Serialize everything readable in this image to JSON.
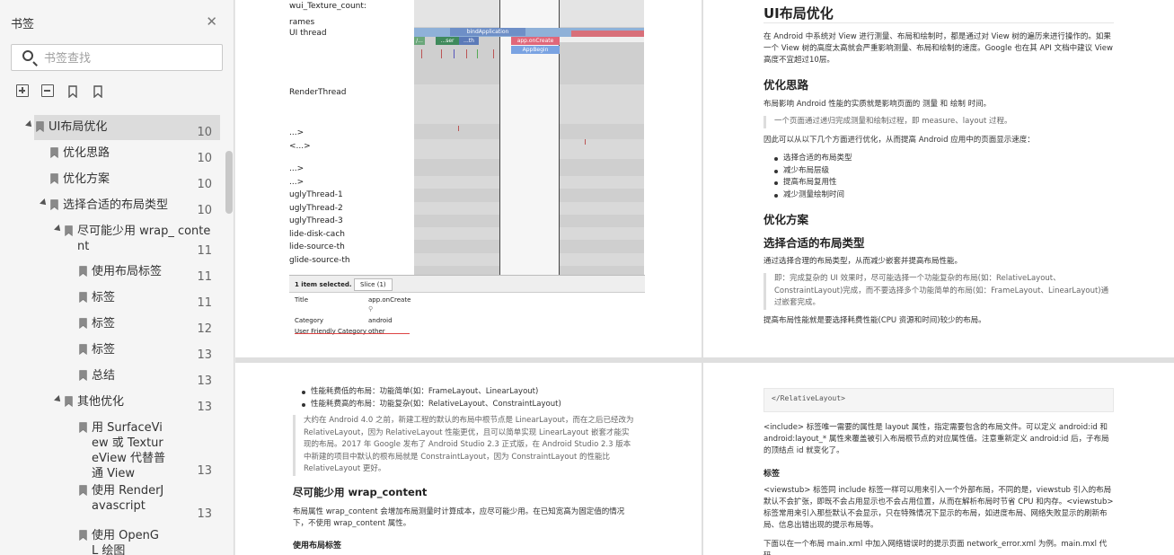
{
  "sidebar": {
    "title": "书签",
    "close_icon": "close-icon",
    "search": {
      "placeholder": "书签查找"
    },
    "tools": [
      "add-bookmark-icon",
      "remove-bookmark-icon",
      "bookmark-icon",
      "bookmark-outline-icon"
    ],
    "items": [
      {
        "label": "UI布局优化",
        "page": "10",
        "level": 0,
        "expanded": true,
        "selected": true
      },
      {
        "label": "优化思路",
        "page": "10",
        "level": 1
      },
      {
        "label": "优化方案",
        "page": "10",
        "level": 1
      },
      {
        "label": "选择合适的布局类型",
        "page": "10",
        "level": 1,
        "expanded": true
      },
      {
        "label": "尽可能少用 wrap_ content",
        "page": "11",
        "level": 2,
        "expanded": true
      },
      {
        "label": "使用布局标签",
        "page": "11",
        "level": 3
      },
      {
        "label": " 标签",
        "page": "11",
        "level": 3
      },
      {
        "label": " 标签",
        "page": "12",
        "level": 3
      },
      {
        "label": " 标签",
        "page": "13",
        "level": 3
      },
      {
        "label": "总结",
        "page": "13",
        "level": 3
      },
      {
        "label": "其他优化",
        "page": "13",
        "level": 2,
        "expanded": true
      },
      {
        "label": "用 SurfaceView 或 TextureView 代替普通 View",
        "page": "13",
        "level": 3
      },
      {
        "label": "使用 RenderJavascript",
        "page": "13",
        "level": 3
      },
      {
        "label": "使用 OpenGL 绘图",
        "page": "",
        "level": 3
      }
    ]
  },
  "page1": {
    "tracks": [
      "wui_Texture_count:",
      "rames",
      "UI thread",
      "RenderThread",
      "...>",
      "<...>",
      "...>",
      "...>",
      "uglyThread-1",
      "uglyThread-2",
      "uglyThread-3",
      "lide-disk-cach",
      "lide-source-th",
      "glide-source-th"
    ],
    "slices": [
      "bindApplication",
      "app.onCreate",
      "AppBegin",
      "/...",
      "...ser",
      "...th"
    ],
    "panel": {
      "selected": "1 item selected.",
      "tab": "Slice (1)",
      "rows": [
        {
          "key": "Title",
          "value": "app.onCreate"
        },
        {
          "key": "Category",
          "value": "android"
        },
        {
          "key": "User Friendly Category",
          "value": "other"
        }
      ]
    }
  },
  "page2": {
    "title": "UI布局优化",
    "intro": "在 Android 中系统对 View 进行测量、布局和绘制时，都是通过对 View 树的遍历来进行操作的。如果一个 View 树的高度太高就会严重影响测量、布局和绘制的速度。Google 也在其 API 文档中建议 View 高度不宜超过10层。",
    "h_ideas": "优化思路",
    "ideas_p": "布局影响 Android 性能的实质就是影响页面的 测量 和 绘制 时间。",
    "ideas_quote": "一个页面通过递归完成测量和绘制过程，即 measure、layout 过程。",
    "ideas_p2": "因此可以从以下几个方面进行优化，从而提高 Android 应用中的页面显示速度：",
    "bullets": [
      "选择合适的布局类型",
      "减少布局层级",
      "提高布局复用性",
      "减少测量绘制时间"
    ],
    "h_plan": "优化方案",
    "h_choose": "选择合适的布局类型",
    "choose_p": "通过选择合理的布局类型，从而减少嵌套并提高布局性能。",
    "choose_quote": "即：完成复杂的 UI 效果时，尽可能选择一个功能复杂的布局(如：RelativeLayout、ConstraintLayout)完成，而不要选择多个功能简单的布局(如：FrameLayout、LinearLayout)通过嵌套完成。",
    "choose_p2": "提高布局性能就是要选择耗费性能(CPU 资源和时间)较少的布局。"
  },
  "page3": {
    "bullets": [
      "性能耗费低的布局：功能简单(如：FrameLayout、LinearLayout)",
      "性能耗费高的布局：功能复杂(如：RelativeLayout、ConstraintLayout)"
    ],
    "quote": "大约在 Android 4.0 之前，新建工程的默认的布局中根节点是 LinearLayout，而在之后已经改为 RelativeLayout，因为 RelativeLayout 性能更优，且可以简单实现 LinearLayout 嵌套才能实现的布局。2017 年 Google 发布了 Android Studio 2.3 正式版，在 Android Studio 2.3 版本中新建的项目中默认的根布局就是 ConstraintLayout，因为 ConstraintLayout 的性能比 RelativeLayout 更好。",
    "h_wrap": "尽可能少用 wrap_content",
    "wrap_p": "布局属性 wrap_content 会增加布局测量时计算成本，应尽可能少用。在已知宽高为固定值的情况下，不使用 wrap_content 属性。",
    "h_tags": "使用布局标签"
  },
  "page4": {
    "code": "</RelativeLayout>",
    "p1": "<include> 标签唯一需要的属性是 layout 属性，指定需要包含的布局文件。可以定义 android:id 和 android:layout_* 属性来覆盖被引入布局根节点的对应属性值。注意重新定义 android:id 后，子布局的顶结点 id 就变化了。",
    "h_tag": "标签",
    "p2": "<viewstub> 标签同 include 标签一样可以用来引入一个外部布局，不同的是，viewstub 引入的布局默认不会扩张，即既不会占用显示也不会占用位置，从而在解析布局时节省 CPU 和内存。<viewstub> 标签常用来引入那些默认不会显示，只在特殊情况下显示的布局，如进度布局、网络失败显示的刷新布局、信息出错出现的提示布局等。",
    "p3": "下面以在一个布局 main.xml 中加入网络错误时的提示页面 network_error.xml 为例。main.mxl 代码"
  }
}
